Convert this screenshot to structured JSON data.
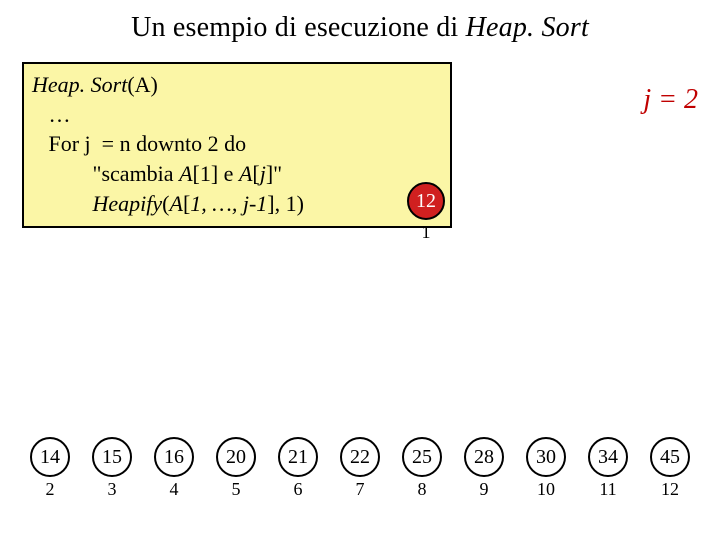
{
  "title": {
    "prefix": "Un esempio di esecuzione di ",
    "alg": "Heap. Sort"
  },
  "code": {
    "l1a": "Heap. Sort",
    "l1b": "(A)",
    "l2": "   …",
    "l3": "   For j  = n downto 2 do",
    "l4a": "           \"scambia ",
    "l4b": "A",
    "l4c": "[1] e ",
    "l4d": "A",
    "l4e": "[",
    "l4f": "j",
    "l4g": "]\"",
    "l5a": "           Heapify",
    "l5b": "(",
    "l5c": "A",
    "l5d": "[",
    "l5e": "1, …, j-1",
    "l5f": "], 1)"
  },
  "j_label": "j = 2",
  "root": {
    "value": "12",
    "index": "1"
  },
  "cells": [
    {
      "value": "14",
      "index": "2",
      "color": "white"
    },
    {
      "value": "15",
      "index": "3",
      "color": "white"
    },
    {
      "value": "16",
      "index": "4",
      "color": "white"
    },
    {
      "value": "20",
      "index": "5",
      "color": "white"
    },
    {
      "value": "21",
      "index": "6",
      "color": "white"
    },
    {
      "value": "22",
      "index": "7",
      "color": "white"
    },
    {
      "value": "25",
      "index": "8",
      "color": "white"
    },
    {
      "value": "28",
      "index": "9",
      "color": "white"
    },
    {
      "value": "30",
      "index": "10",
      "color": "white"
    },
    {
      "value": "34",
      "index": "11",
      "color": "white"
    },
    {
      "value": "45",
      "index": "12",
      "color": "white"
    }
  ]
}
